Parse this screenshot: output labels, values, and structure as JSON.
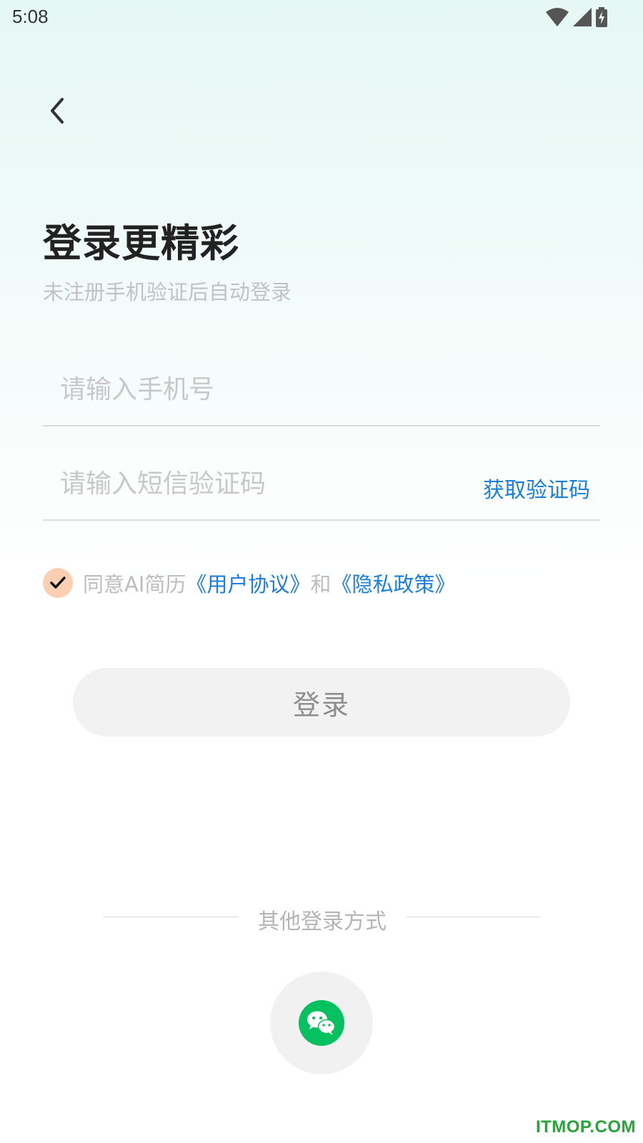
{
  "status_bar": {
    "time": "5:08",
    "icons": [
      "wifi-icon",
      "signal-icon",
      "battery-charging-icon"
    ]
  },
  "header": {
    "back_icon": "chevron-left-icon"
  },
  "title": "登录更精彩",
  "subtitle": "未注册手机验证后自动登录",
  "phone_field": {
    "placeholder": "请输入手机号",
    "value": ""
  },
  "code_field": {
    "placeholder": "请输入短信验证码",
    "value": "",
    "get_code_label": "获取验证码"
  },
  "agreement": {
    "checked": true,
    "prefix": "同意AI简历",
    "user_agreement": "《用户协议》",
    "conjunction": "和",
    "privacy_policy": "《隐私政策》"
  },
  "login_button": "登录",
  "other_login": {
    "label": "其他登录方式",
    "icon": "wechat-icon"
  },
  "watermark": "ITMOP.COM",
  "colors": {
    "link": "#1a7fe0",
    "checkbox_bg": "#fbd0b2",
    "wechat_green": "#07c160",
    "watermark": "#2aa33a"
  }
}
